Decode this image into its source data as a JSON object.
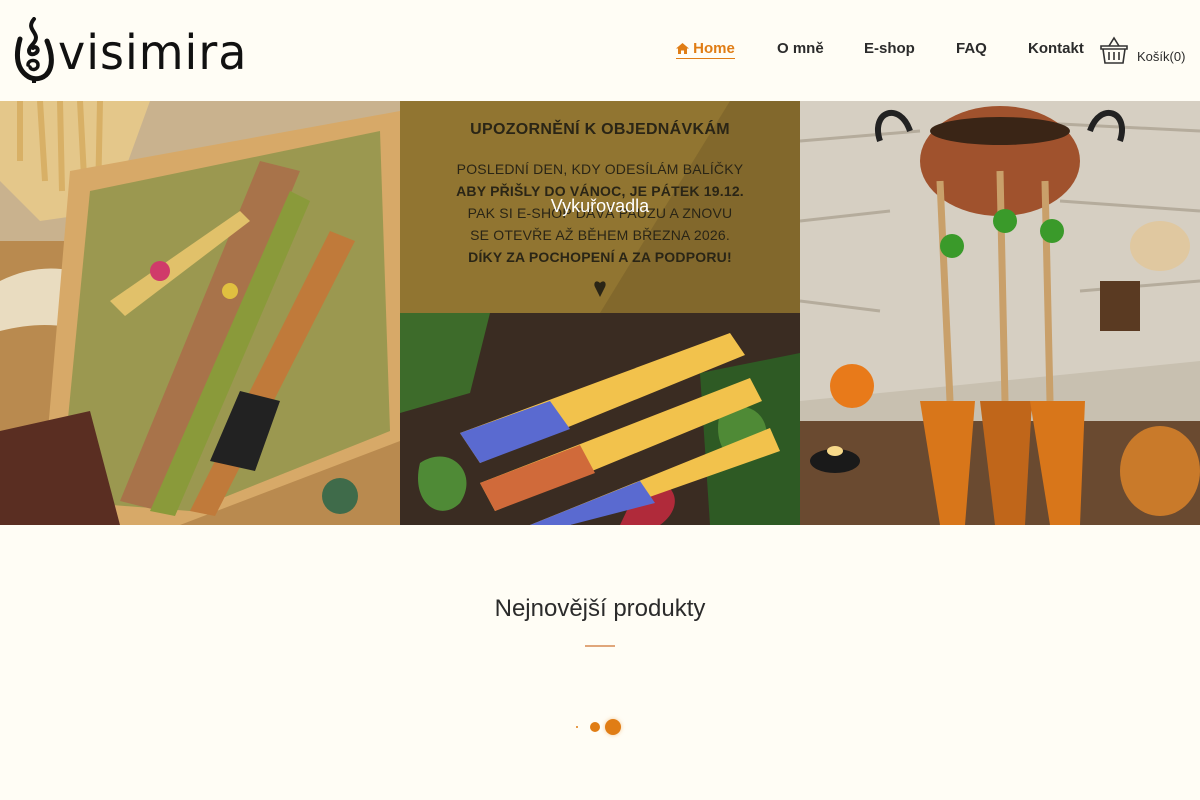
{
  "brand": {
    "name": "visimira"
  },
  "nav": {
    "home": "Home",
    "about": "O mně",
    "eshop": "E-shop",
    "faq": "FAQ",
    "contact": "Kontakt",
    "cart": "Košík(0)"
  },
  "tiles": {
    "notice": {
      "title": "UPOZORNĚNÍ K OBJEDNÁVKÁM",
      "line1": "POSLEDNÍ DEN, KDY ODESÍLÁM BALÍČKY",
      "line2": "ABY PŘIŠLY DO VÁNOC, JE PÁTEK 19.12.",
      "line3": "PAK SI E-SHOP DÁVÁ PAUZU A ZNOVU",
      "line4": "SE OTEVŘE AŽ BĚHEM BŘEZNA 2026.",
      "line5": "DÍKY ZA POCHOPENÍ A ZA PODPORU!"
    },
    "overlay_label": "Vykuřovadla"
  },
  "section": {
    "title": "Nejnovější produkty"
  },
  "colors": {
    "accent": "#e07d15",
    "background": "#fffdf5",
    "text": "#2b2b2b"
  },
  "icons": {
    "home": "home-icon",
    "cart": "basket-icon",
    "logo": "flame-spiral-icon"
  }
}
